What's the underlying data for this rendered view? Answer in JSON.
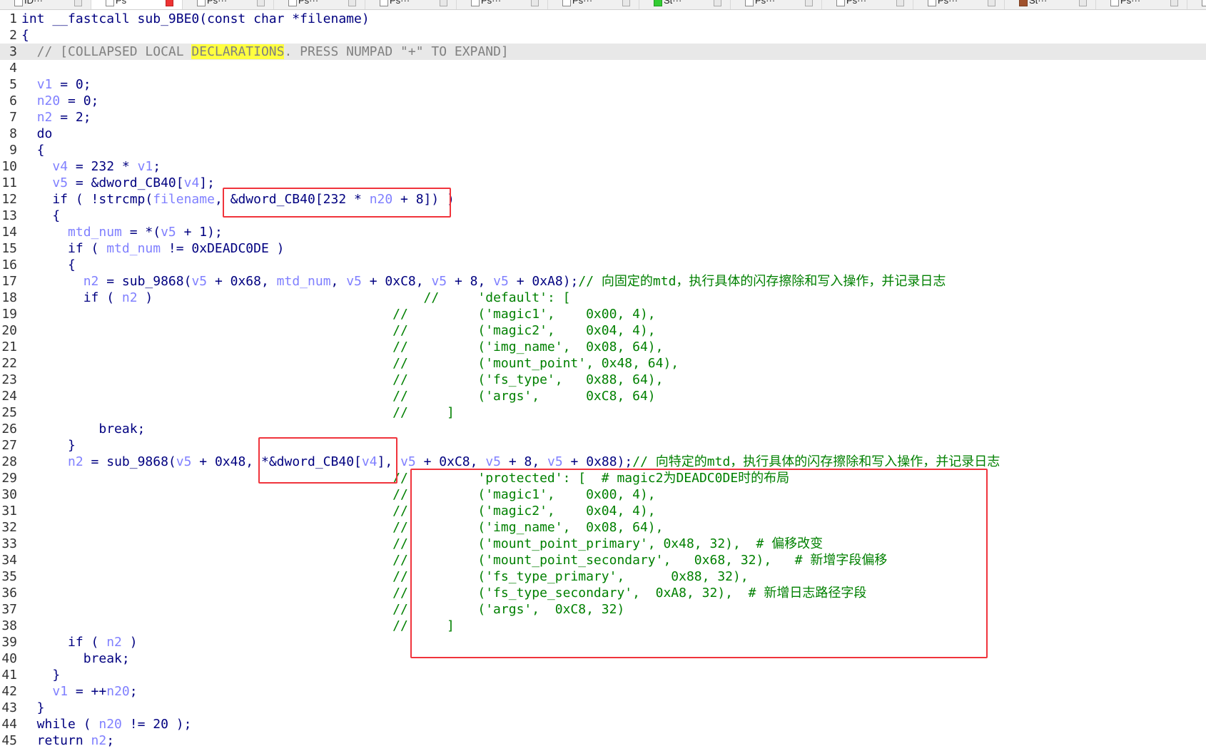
{
  "tabs": [
    {
      "label": "ID···",
      "icon": "document-icon"
    },
    {
      "label": "Ps",
      "icon": "document-icon",
      "active": true
    },
    {
      "label": "Ps···",
      "icon": "document-icon"
    },
    {
      "label": "Ps···",
      "icon": "document-icon"
    },
    {
      "label": "Ps···",
      "icon": "document-icon"
    },
    {
      "label": "Ps···",
      "icon": "document-icon"
    },
    {
      "label": "Ps···",
      "icon": "document-icon"
    },
    {
      "label": "St···",
      "icon": "structure-icon"
    },
    {
      "label": "Ps···",
      "icon": "document-icon"
    },
    {
      "label": "Ps···",
      "icon": "document-icon"
    },
    {
      "label": "Ps···",
      "icon": "document-icon"
    },
    {
      "label": "St···",
      "icon": "bird-icon"
    },
    {
      "label": "Ps···",
      "icon": "document-icon"
    },
    {
      "label": "",
      "icon": "document-icon"
    }
  ],
  "colors": {
    "keyword": "#000080",
    "variable": "#8080ff",
    "comment": "#008000",
    "highlight": "#ffff40",
    "annotation_box": "#f0343c"
  },
  "lines": [
    [
      [
        "int __fastcall sub_9BE0(const char *filename)",
        "k"
      ]
    ],
    [
      [
        "{",
        "k"
      ]
    ],
    [
      [
        "  // [COLLAPSED LOCAL ",
        "g"
      ],
      [
        "DECLARATIONS",
        "h"
      ],
      [
        ". PRESS NUMPAD \"+\" TO EXPAND]",
        "g"
      ]
    ],
    [
      [
        "",
        ""
      ]
    ],
    [
      [
        "  ",
        "k"
      ],
      [
        "v1",
        "v"
      ],
      [
        " = 0;",
        "k"
      ]
    ],
    [
      [
        "  ",
        "k"
      ],
      [
        "n20",
        "v"
      ],
      [
        " = 0;",
        "k"
      ]
    ],
    [
      [
        "  ",
        "k"
      ],
      [
        "n2",
        "v"
      ],
      [
        " = 2;",
        "k"
      ]
    ],
    [
      [
        "  do",
        "k"
      ]
    ],
    [
      [
        "  {",
        "k"
      ]
    ],
    [
      [
        "    ",
        "k"
      ],
      [
        "v4",
        "v"
      ],
      [
        " = 232 * ",
        "k"
      ],
      [
        "v1",
        "v"
      ],
      [
        ";",
        "k"
      ]
    ],
    [
      [
        "    ",
        "k"
      ],
      [
        "v5",
        "v"
      ],
      [
        " = &dword_CB40[",
        "k"
      ],
      [
        "v4",
        "v"
      ],
      [
        "];",
        "k"
      ]
    ],
    [
      [
        "    if ( !strcmp(",
        "k"
      ],
      [
        "filename",
        "v"
      ],
      [
        ", &dword_CB40[232 * ",
        "k"
      ],
      [
        "n20",
        "v"
      ],
      [
        " + 8]) )",
        "k"
      ]
    ],
    [
      [
        "    {",
        "k"
      ]
    ],
    [
      [
        "      ",
        "k"
      ],
      [
        "mtd_num",
        "v"
      ],
      [
        " = *(",
        "k"
      ],
      [
        "v5",
        "v"
      ],
      [
        " + 1);",
        "k"
      ]
    ],
    [
      [
        "      if ( ",
        "k"
      ],
      [
        "mtd_num",
        "v"
      ],
      [
        " != 0xDEADC0DE )",
        "k"
      ]
    ],
    [
      [
        "      {",
        "k"
      ]
    ],
    [
      [
        "        ",
        "k"
      ],
      [
        "n2",
        "v"
      ],
      [
        " = sub_9868(",
        "k"
      ],
      [
        "v5",
        "v"
      ],
      [
        " + 0x68, ",
        "k"
      ],
      [
        "mtd_num",
        "v"
      ],
      [
        ", ",
        "k"
      ],
      [
        "v5",
        "v"
      ],
      [
        " + 0xC8, ",
        "k"
      ],
      [
        "v5",
        "v"
      ],
      [
        " + 8, ",
        "k"
      ],
      [
        "v5",
        "v"
      ],
      [
        " + 0xA8);",
        "k"
      ],
      [
        "// 向固定的mtd，执行具体的闪存擦除和写入操作，并记录日志",
        "c"
      ]
    ],
    [
      [
        "        if ( ",
        "k"
      ],
      [
        "n2",
        "v"
      ],
      [
        " )                                   ",
        "k"
      ],
      [
        "//     'default': [",
        "c"
      ]
    ],
    [
      [
        "                                                ",
        "k"
      ],
      [
        "//         ('magic1',    0x00, 4),",
        "c"
      ]
    ],
    [
      [
        "                                                ",
        "k"
      ],
      [
        "//         ('magic2',    0x04, 4),",
        "c"
      ]
    ],
    [
      [
        "                                                ",
        "k"
      ],
      [
        "//         ('img_name',  0x08, 64),",
        "c"
      ]
    ],
    [
      [
        "                                                ",
        "k"
      ],
      [
        "//         ('mount_point', 0x48, 64),",
        "c"
      ]
    ],
    [
      [
        "                                                ",
        "k"
      ],
      [
        "//         ('fs_type',   0x88, 64),",
        "c"
      ]
    ],
    [
      [
        "                                                ",
        "k"
      ],
      [
        "//         ('args',      0xC8, 64)",
        "c"
      ]
    ],
    [
      [
        "                                                ",
        "k"
      ],
      [
        "//     ]",
        "c"
      ]
    ],
    [
      [
        "          break;",
        "k"
      ]
    ],
    [
      [
        "      }",
        "k"
      ]
    ],
    [
      [
        "      ",
        "k"
      ],
      [
        "n2",
        "v"
      ],
      [
        " = sub_9868(",
        "k"
      ],
      [
        "v5",
        "v"
      ],
      [
        " + 0x48, *&dword_CB40[",
        "k"
      ],
      [
        "v4",
        "v"
      ],
      [
        "], ",
        "k"
      ],
      [
        "v5",
        "v"
      ],
      [
        " + 0xC8, ",
        "k"
      ],
      [
        "v5",
        "v"
      ],
      [
        " + 8, ",
        "k"
      ],
      [
        "v5",
        "v"
      ],
      [
        " + 0x88);",
        "k"
      ],
      [
        "// 向特定的mtd，执行具体的闪存擦除和写入操作，并记录日志",
        "c"
      ]
    ],
    [
      [
        "                                                ",
        "k"
      ],
      [
        "//         'protected': [  # magic2为DEADC0DE时的布局",
        "c"
      ]
    ],
    [
      [
        "                                                ",
        "k"
      ],
      [
        "//         ('magic1',    0x00, 4),",
        "c"
      ]
    ],
    [
      [
        "                                                ",
        "k"
      ],
      [
        "//         ('magic2',    0x04, 4),",
        "c"
      ]
    ],
    [
      [
        "                                                ",
        "k"
      ],
      [
        "//         ('img_name',  0x08, 64),",
        "c"
      ]
    ],
    [
      [
        "                                                ",
        "k"
      ],
      [
        "//         ('mount_point_primary', 0x48, 32),  # 偏移改变",
        "c"
      ]
    ],
    [
      [
        "                                                ",
        "k"
      ],
      [
        "//         ('mount_point_secondary',   0x68, 32),   # 新增字段偏移",
        "c"
      ]
    ],
    [
      [
        "                                                ",
        "k"
      ],
      [
        "//         ('fs_type_primary',      0x88, 32),",
        "c"
      ]
    ],
    [
      [
        "                                                ",
        "k"
      ],
      [
        "//         ('fs_type_secondary',  0xA8, 32),  # 新增日志路径字段",
        "c"
      ]
    ],
    [
      [
        "                                                ",
        "k"
      ],
      [
        "//         ('args',  0xC8, 32)",
        "c"
      ]
    ],
    [
      [
        "                                                ",
        "k"
      ],
      [
        "//     ]",
        "c"
      ]
    ],
    [
      [
        "      if ( ",
        "k"
      ],
      [
        "n2",
        "v"
      ],
      [
        " )",
        "k"
      ]
    ],
    [
      [
        "        break;",
        "k"
      ]
    ],
    [
      [
        "    }",
        "k"
      ]
    ],
    [
      [
        "    ",
        "k"
      ],
      [
        "v1",
        "v"
      ],
      [
        " = ++",
        "k"
      ],
      [
        "n20",
        "v"
      ],
      [
        ";",
        "k"
      ]
    ],
    [
      [
        "  }",
        "k"
      ]
    ],
    [
      [
        "  while ( ",
        "k"
      ],
      [
        "n20",
        "v"
      ],
      [
        " != 20 );",
        "k"
      ]
    ],
    [
      [
        "  return ",
        "k"
      ],
      [
        "n2",
        "v"
      ],
      [
        ";",
        "k"
      ]
    ]
  ]
}
